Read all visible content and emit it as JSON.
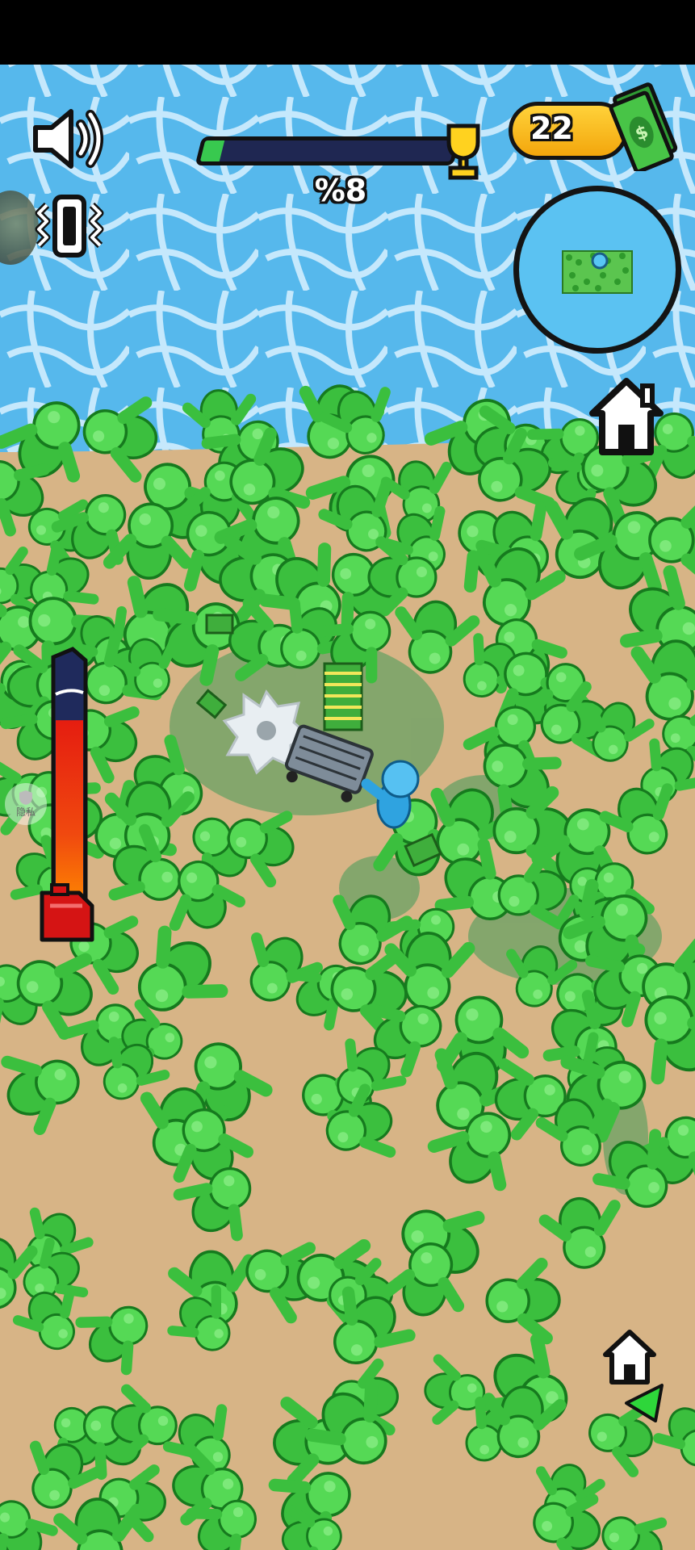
{
  "hud": {
    "level_progress": 0.08,
    "progress_label": "%8",
    "money": "22",
    "privacy_label": "隐私"
  },
  "colors": {
    "water": "#56b8ec",
    "sand": "#d7b486",
    "zombie": "#4fd34e",
    "player": "#46b6ee",
    "progress_fill": "#38c94f",
    "progress_track": "#1f2752",
    "money_pill": "#f6b219"
  },
  "icons": [
    "speaker-icon",
    "vibrate-icon",
    "trophy-icon",
    "cash-icon",
    "home-icon",
    "fuel-can-icon",
    "shield-icon",
    "arrow-icon"
  ],
  "fuel_level": 0.88
}
